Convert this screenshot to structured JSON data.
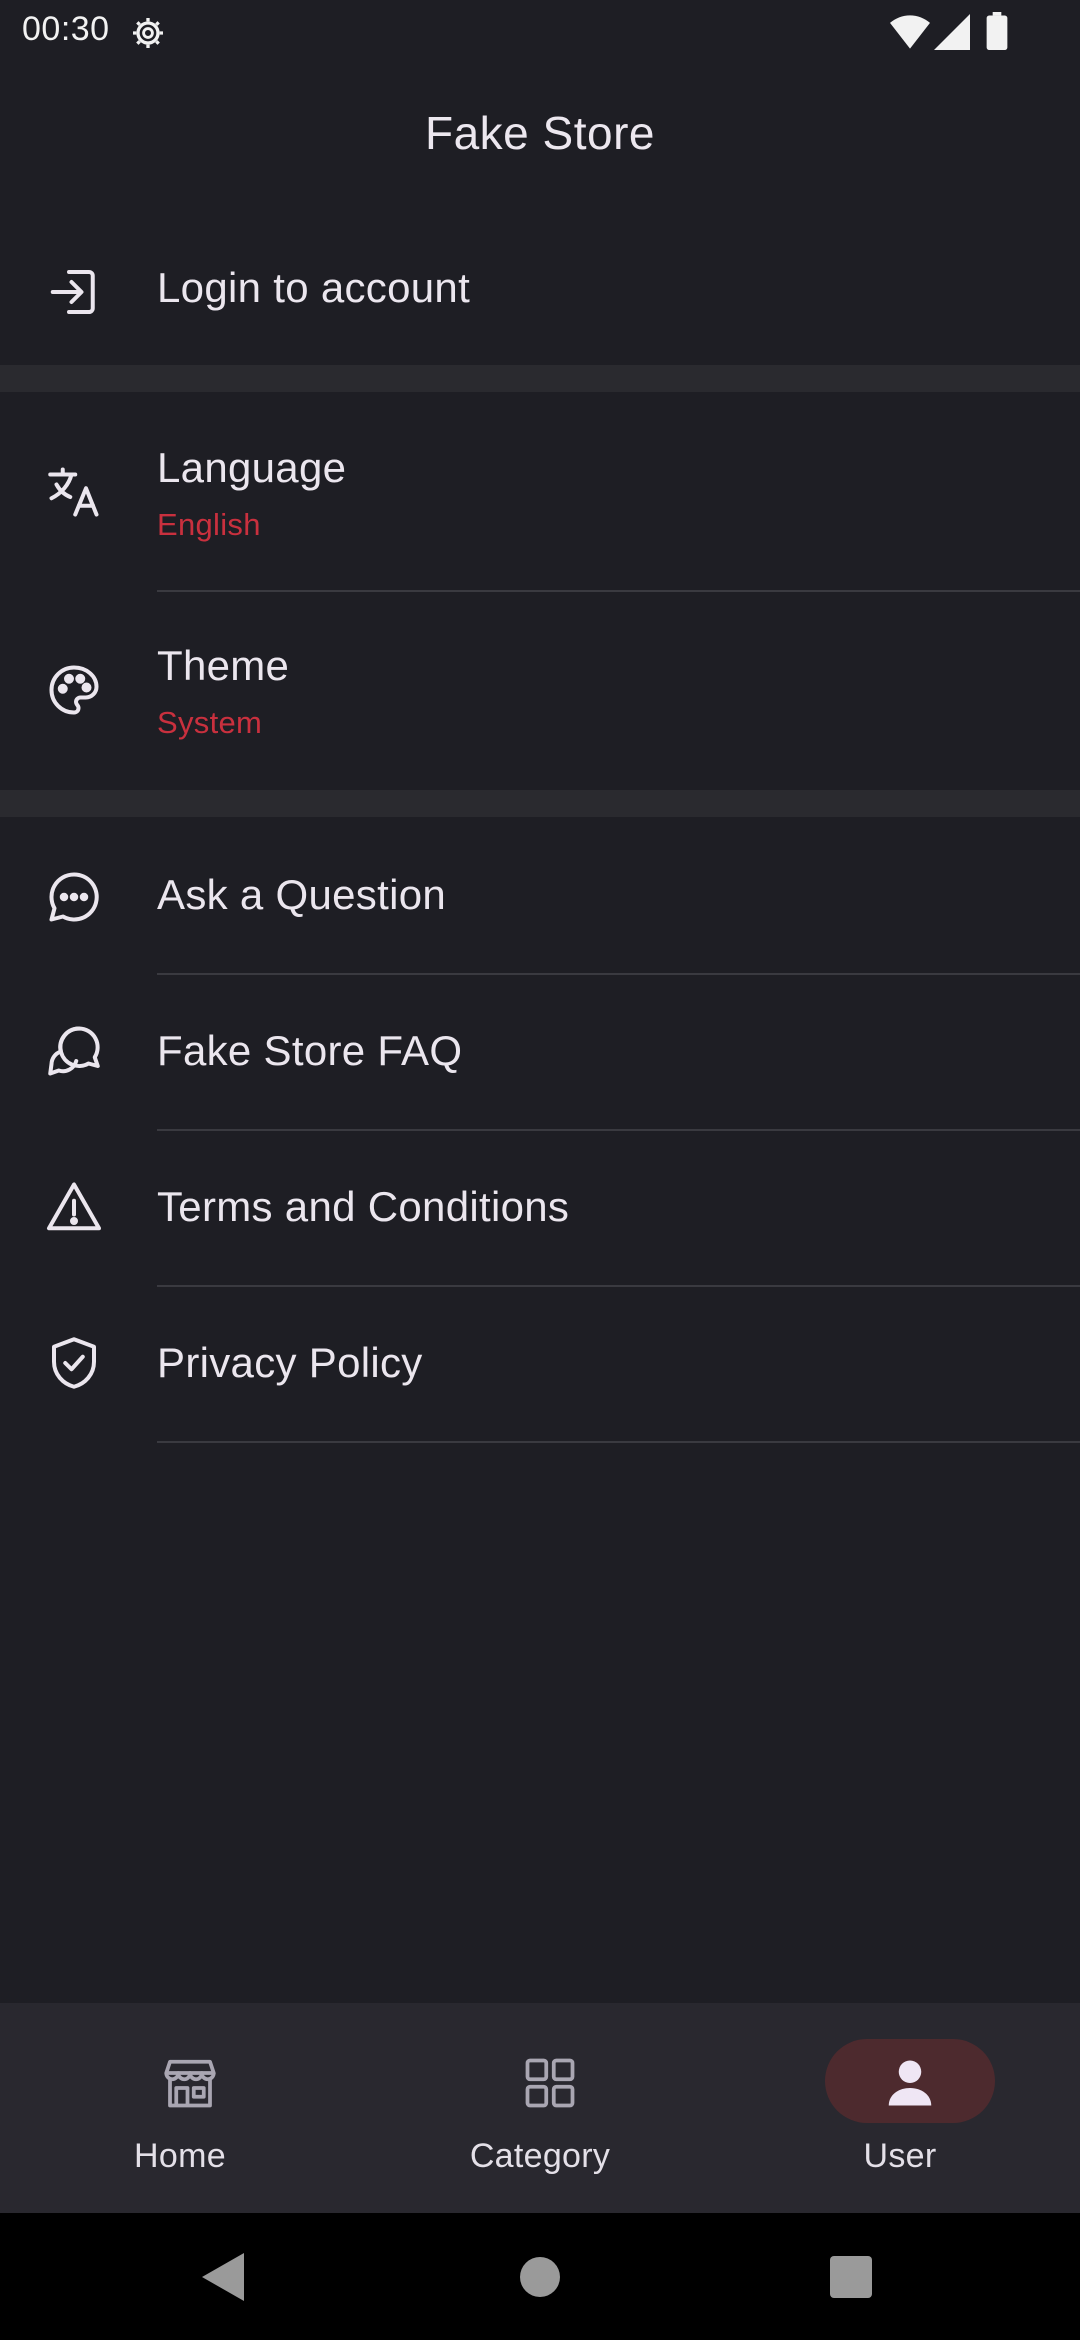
{
  "status_bar": {
    "time": "00:30",
    "icons": [
      "gear-icon",
      "wifi-icon",
      "signal-icon",
      "battery-icon"
    ]
  },
  "app_bar": {
    "title": "Fake Store"
  },
  "account": {
    "login_label": "Login to account"
  },
  "settings": {
    "language_label": "Language",
    "language_value": "English",
    "theme_label": "Theme",
    "theme_value": "System"
  },
  "support": {
    "ask_question": "Ask a Question",
    "faq": "Fake Store FAQ",
    "terms": "Terms and Conditions",
    "privacy": "Privacy Policy"
  },
  "bottom_nav": {
    "items": [
      {
        "label": "Home",
        "icon": "store-icon",
        "active": false
      },
      {
        "label": "Category",
        "icon": "grid-icon",
        "active": false
      },
      {
        "label": "User",
        "icon": "person-icon",
        "active": true
      }
    ]
  },
  "colors": {
    "background": "#1e1e24",
    "accent": "#c9303e",
    "nav_background": "#29282f",
    "nav_active_pill": "#4d2a2e"
  }
}
